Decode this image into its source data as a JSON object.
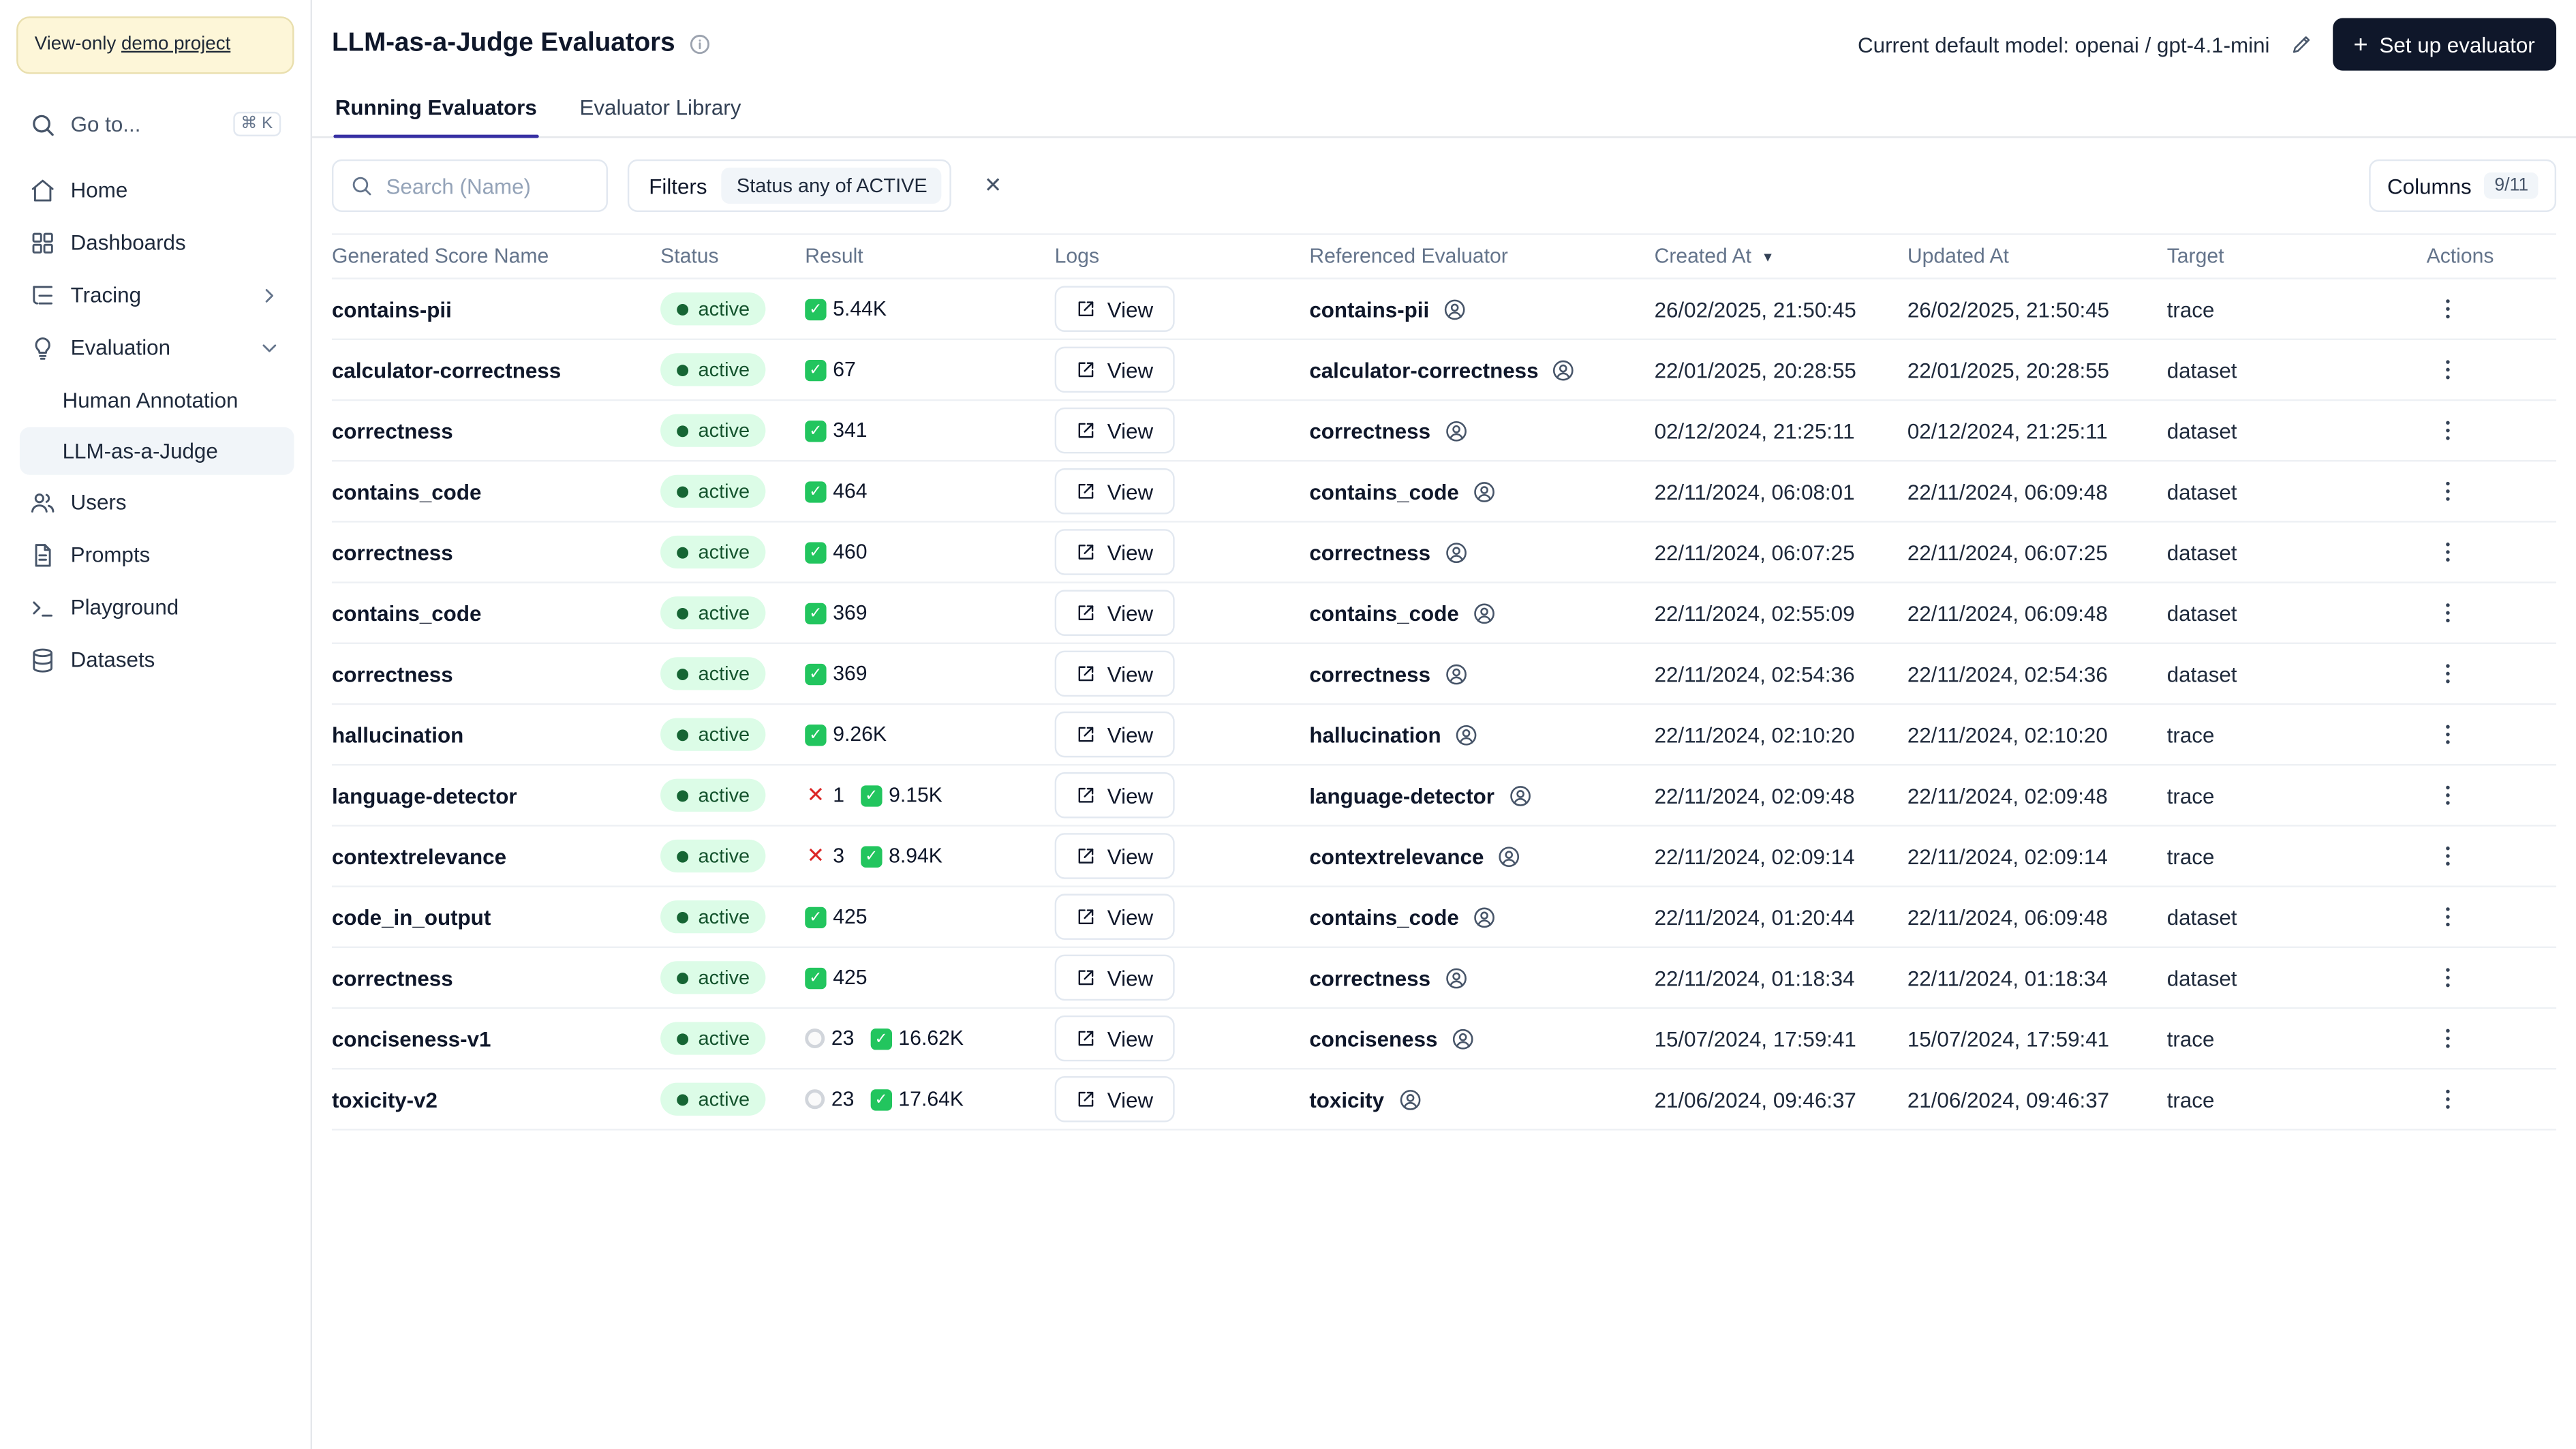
{
  "sidebar": {
    "banner": {
      "prefix": "View-only ",
      "link_label": "demo project"
    },
    "goto_label": "Go to...",
    "goto_shortcut": "⌘ K",
    "items": [
      {
        "label": "Home"
      },
      {
        "label": "Dashboards"
      },
      {
        "label": "Tracing"
      },
      {
        "label": "Evaluation"
      },
      {
        "label": "Human Annotation"
      },
      {
        "label": "LLM-as-a-Judge"
      },
      {
        "label": "Users"
      },
      {
        "label": "Prompts"
      },
      {
        "label": "Playground"
      },
      {
        "label": "Datasets"
      }
    ]
  },
  "header": {
    "title": "LLM-as-a-Judge Evaluators",
    "default_model_label": "Current default model: openai / gpt-4.1-mini",
    "setup_button_label": "Set up evaluator"
  },
  "tabs": [
    {
      "label": "Running Evaluators"
    },
    {
      "label": "Evaluator Library"
    }
  ],
  "toolbar": {
    "search_placeholder": "Search (Name)",
    "filters_label": "Filters",
    "filter_chip": "Status any of ACTIVE",
    "columns_label": "Columns",
    "columns_count": "9/11"
  },
  "icons": {
    "success": "✓",
    "error": "✕",
    "pending": "circle",
    "sort_desc": "▼",
    "close": "✕",
    "plus": "+"
  },
  "colors": {
    "primary_button_bg": "#0f172a",
    "active_tab_indicator": "#3730a3",
    "status_active_bg": "#dcfce7",
    "status_active_text": "#14532d",
    "success_badge": "#22c55e",
    "error_badge": "#dc2626",
    "banner_bg": "#fdf6d8"
  },
  "table": {
    "columns": [
      "Generated Score Name",
      "Status",
      "Result",
      "Logs",
      "Referenced Evaluator",
      "Created At",
      "Updated At",
      "Target",
      "Actions"
    ],
    "sort_column": "Created At",
    "sort_direction": "desc",
    "rows": [
      {
        "name": "contains-pii",
        "status": "active",
        "result": [
          {
            "kind": "success",
            "count": "5.44K"
          }
        ],
        "logs": "View",
        "referenced": "contains-pii",
        "created": "26/02/2025, 21:50:45",
        "updated": "26/02/2025, 21:50:45",
        "target": "trace"
      },
      {
        "name": "calculator-correctness",
        "status": "active",
        "result": [
          {
            "kind": "success",
            "count": "67"
          }
        ],
        "logs": "View",
        "referenced": "calculator-correctness",
        "created": "22/01/2025, 20:28:55",
        "updated": "22/01/2025, 20:28:55",
        "target": "dataset"
      },
      {
        "name": "correctness",
        "status": "active",
        "result": [
          {
            "kind": "success",
            "count": "341"
          }
        ],
        "logs": "View",
        "referenced": "correctness",
        "created": "02/12/2024, 21:25:11",
        "updated": "02/12/2024, 21:25:11",
        "target": "dataset"
      },
      {
        "name": "contains_code",
        "status": "active",
        "result": [
          {
            "kind": "success",
            "count": "464"
          }
        ],
        "logs": "View",
        "referenced": "contains_code",
        "created": "22/11/2024, 06:08:01",
        "updated": "22/11/2024, 06:09:48",
        "target": "dataset"
      },
      {
        "name": "correctness",
        "status": "active",
        "result": [
          {
            "kind": "success",
            "count": "460"
          }
        ],
        "logs": "View",
        "referenced": "correctness",
        "created": "22/11/2024, 06:07:25",
        "updated": "22/11/2024, 06:07:25",
        "target": "dataset"
      },
      {
        "name": "contains_code",
        "status": "active",
        "result": [
          {
            "kind": "success",
            "count": "369"
          }
        ],
        "logs": "View",
        "referenced": "contains_code",
        "created": "22/11/2024, 02:55:09",
        "updated": "22/11/2024, 06:09:48",
        "target": "dataset"
      },
      {
        "name": "correctness",
        "status": "active",
        "result": [
          {
            "kind": "success",
            "count": "369"
          }
        ],
        "logs": "View",
        "referenced": "correctness",
        "created": "22/11/2024, 02:54:36",
        "updated": "22/11/2024, 02:54:36",
        "target": "dataset"
      },
      {
        "name": "hallucination",
        "status": "active",
        "result": [
          {
            "kind": "success",
            "count": "9.26K"
          }
        ],
        "logs": "View",
        "referenced": "hallucination",
        "created": "22/11/2024, 02:10:20",
        "updated": "22/11/2024, 02:10:20",
        "target": "trace"
      },
      {
        "name": "language-detector",
        "status": "active",
        "result": [
          {
            "kind": "error",
            "count": "1"
          },
          {
            "kind": "success",
            "count": "9.15K"
          }
        ],
        "logs": "View",
        "referenced": "language-detector",
        "created": "22/11/2024, 02:09:48",
        "updated": "22/11/2024, 02:09:48",
        "target": "trace"
      },
      {
        "name": "contextrelevance",
        "status": "active",
        "result": [
          {
            "kind": "error",
            "count": "3"
          },
          {
            "kind": "success",
            "count": "8.94K"
          }
        ],
        "logs": "View",
        "referenced": "contextrelevance",
        "created": "22/11/2024, 02:09:14",
        "updated": "22/11/2024, 02:09:14",
        "target": "trace"
      },
      {
        "name": "code_in_output",
        "status": "active",
        "result": [
          {
            "kind": "success",
            "count": "425"
          }
        ],
        "logs": "View",
        "referenced": "contains_code",
        "created": "22/11/2024, 01:20:44",
        "updated": "22/11/2024, 06:09:48",
        "target": "dataset"
      },
      {
        "name": "correctness",
        "status": "active",
        "result": [
          {
            "kind": "success",
            "count": "425"
          }
        ],
        "logs": "View",
        "referenced": "correctness",
        "created": "22/11/2024, 01:18:34",
        "updated": "22/11/2024, 01:18:34",
        "target": "dataset"
      },
      {
        "name": "conciseness-v1",
        "status": "active",
        "result": [
          {
            "kind": "pending",
            "count": "23"
          },
          {
            "kind": "success",
            "count": "16.62K"
          }
        ],
        "logs": "View",
        "referenced": "conciseness",
        "created": "15/07/2024, 17:59:41",
        "updated": "15/07/2024, 17:59:41",
        "target": "trace"
      },
      {
        "name": "toxicity-v2",
        "status": "active",
        "result": [
          {
            "kind": "pending",
            "count": "23"
          },
          {
            "kind": "success",
            "count": "17.64K"
          }
        ],
        "logs": "View",
        "referenced": "toxicity",
        "created": "21/06/2024, 09:46:37",
        "updated": "21/06/2024, 09:46:37",
        "target": "trace"
      }
    ]
  }
}
